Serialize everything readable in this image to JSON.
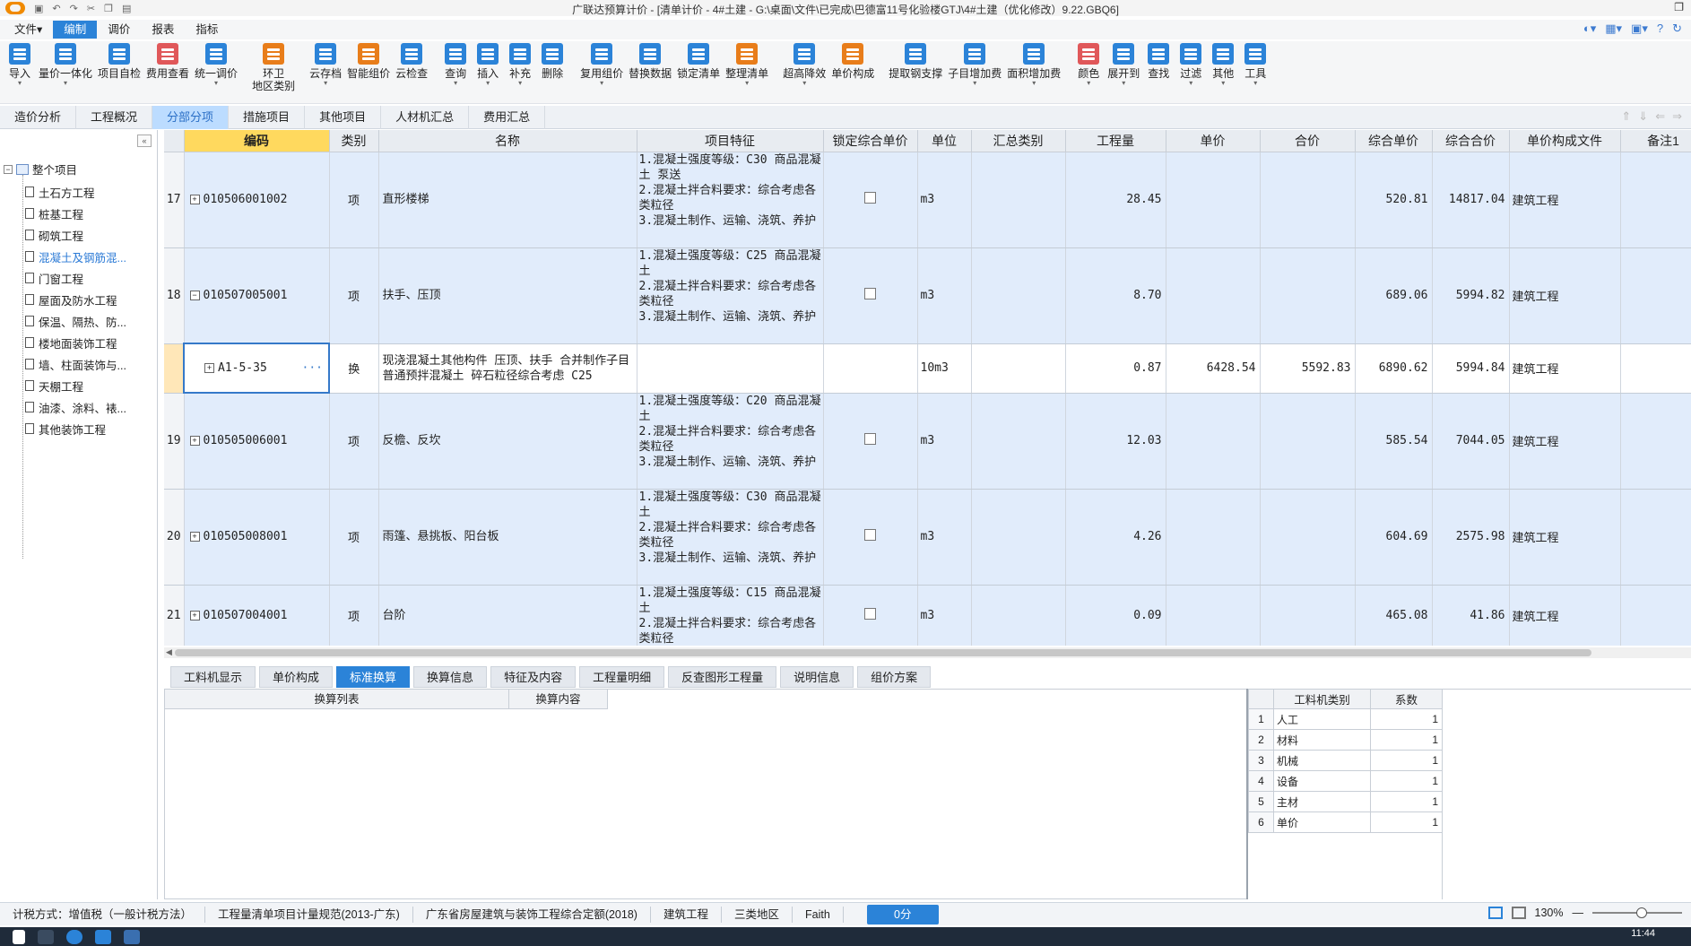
{
  "window": {
    "title": "广联达预算计价 - [清单计价 - 4#土建 - G:\\桌面\\文件\\已完成\\巴德富11号化验楼GTJ\\4#土建（优化修改）9.22.GBQ6]",
    "min_glyph": "—",
    "max_glyph": "▫",
    "restore_glyph": "❐",
    "close_glyph": "✕"
  },
  "menubar": {
    "items": [
      {
        "label": "文件▾",
        "active": false
      },
      {
        "label": "编制",
        "active": true
      },
      {
        "label": "调价",
        "active": false
      },
      {
        "label": "报表",
        "active": false
      },
      {
        "label": "指标",
        "active": false
      }
    ]
  },
  "toolbar": {
    "items": [
      {
        "label": "导入",
        "color": "#2b83d8",
        "caret": true
      },
      {
        "label": "量价一体化",
        "color": "#2b83d8",
        "caret": true
      },
      {
        "label": "项目自检",
        "color": "#2b83d8",
        "caret": false
      },
      {
        "label": "费用查看",
        "color": "#e0585a",
        "caret": false
      },
      {
        "label": "统一调价",
        "color": "#2b83d8",
        "caret": true
      },
      {
        "label": "环卫",
        "label2": "地区类别",
        "color": "#e87d1a",
        "caret": false
      },
      {
        "label": "云存档",
        "color": "#2b83d8",
        "caret": true
      },
      {
        "label": "智能组价",
        "color": "#e87d1a",
        "caret": false
      },
      {
        "label": "云检查",
        "color": "#2b83d8",
        "caret": false
      },
      {
        "label": "查询",
        "color": "#2b83d8",
        "caret": true
      },
      {
        "label": "插入",
        "color": "#2b83d8",
        "caret": true
      },
      {
        "label": "补充",
        "color": "#2b83d8",
        "caret": true
      },
      {
        "label": "删除",
        "color": "#2b83d8",
        "caret": false
      },
      {
        "label": "复用组价",
        "color": "#2b83d8",
        "caret": true
      },
      {
        "label": "替换数据",
        "color": "#2b83d8",
        "caret": false
      },
      {
        "label": "锁定清单",
        "color": "#2b83d8",
        "caret": false
      },
      {
        "label": "整理清单",
        "color": "#e87d1a",
        "caret": true
      },
      {
        "label": "超高降效",
        "color": "#2b83d8",
        "caret": true
      },
      {
        "label": "单价构成",
        "color": "#e87d1a",
        "caret": false
      },
      {
        "label": "提取钢支撑",
        "color": "#2b83d8",
        "caret": false
      },
      {
        "label": "子目增加费",
        "color": "#2b83d8",
        "caret": true
      },
      {
        "label": "面积增加费",
        "color": "#2b83d8",
        "caret": true
      },
      {
        "label": "颜色",
        "color": "#e0585a",
        "caret": true
      },
      {
        "label": "展开到",
        "color": "#2b83d8",
        "caret": true
      },
      {
        "label": "查找",
        "color": "#2b83d8",
        "caret": false
      },
      {
        "label": "过滤",
        "color": "#2b83d8",
        "caret": true
      },
      {
        "label": "其他",
        "color": "#2b83d8",
        "caret": true
      },
      {
        "label": "工具",
        "color": "#2b83d8",
        "caret": true
      }
    ]
  },
  "viewtabs": [
    {
      "label": "造价分析",
      "active": false
    },
    {
      "label": "工程概况",
      "active": false
    },
    {
      "label": "分部分项",
      "active": true
    },
    {
      "label": "措施项目",
      "active": false
    },
    {
      "label": "其他项目",
      "active": false
    },
    {
      "label": "人材机汇总",
      "active": false
    },
    {
      "label": "费用汇总",
      "active": false
    }
  ],
  "tree": {
    "collapse_label": "«",
    "root_toggle": "−",
    "root": "整个项目",
    "items": [
      {
        "label": "土石方工程",
        "active": false
      },
      {
        "label": "桩基工程",
        "active": false
      },
      {
        "label": "砌筑工程",
        "active": false
      },
      {
        "label": "混凝土及钢筋混...",
        "active": true
      },
      {
        "label": "门窗工程",
        "active": false
      },
      {
        "label": "屋面及防水工程",
        "active": false
      },
      {
        "label": "保温、隔热、防...",
        "active": false
      },
      {
        "label": "楼地面装饰工程",
        "active": false
      },
      {
        "label": "墙、柱面装饰与...",
        "active": false
      },
      {
        "label": "天棚工程",
        "active": false
      },
      {
        "label": "油漆、涂料、裱...",
        "active": false
      },
      {
        "label": "其他装饰工程",
        "active": false
      }
    ]
  },
  "grid": {
    "columns": [
      "",
      "编码",
      "类别",
      "名称",
      "项目特征",
      "锁定综合单价",
      "单位",
      "汇总类别",
      "工程量",
      "单价",
      "合价",
      "综合单价",
      "综合合价",
      "单价构成文件",
      "备注1"
    ],
    "rows": [
      {
        "type": "item",
        "num": "17",
        "toggle": "+",
        "code": "010506001002",
        "cat": "项",
        "name": "直形楼梯",
        "feature": "1.混凝土强度等级：C30 商品混凝土 泵送\n2.混凝土拌合料要求：综合考虑各类粒径\n3.混凝土制作、运输、浇筑、养护",
        "unit": "m3",
        "qty": "28.45",
        "price": "",
        "total": "",
        "cprice": "520.81",
        "ctotal": "14817.04",
        "file": "建筑工程"
      },
      {
        "type": "item",
        "num": "18",
        "toggle": "−",
        "code": "010507005001",
        "cat": "项",
        "name": "扶手、压顶",
        "feature": "1.混凝土强度等级：C25 商品混凝土\n2.混凝土拌合料要求：综合考虑各类粒径\n3.混凝土制作、运输、浇筑、养护",
        "unit": "m3",
        "qty": "8.70",
        "price": "",
        "total": "",
        "cprice": "689.06",
        "ctotal": "5994.82",
        "file": "建筑工程"
      },
      {
        "type": "sub",
        "num": "",
        "toggle": "+",
        "code": "A1-5-35",
        "dots": "···",
        "cat": "换",
        "name": "现浇混凝土其他构件 压顶、扶手  合并制作子目 普通预拌混凝土 碎石粒径综合考虑 C25",
        "feature": "",
        "unit": "10m3",
        "qty": "0.87",
        "price": "6428.54",
        "total": "5592.83",
        "cprice": "6890.62",
        "ctotal": "5994.84",
        "file": "建筑工程"
      },
      {
        "type": "item",
        "num": "19",
        "toggle": "+",
        "code": "010505006001",
        "cat": "项",
        "name": "反檐、反坎",
        "feature": "1.混凝土强度等级：C20 商品混凝土\n2.混凝土拌合料要求：综合考虑各类粒径\n3.混凝土制作、运输、浇筑、养护",
        "unit": "m3",
        "qty": "12.03",
        "price": "",
        "total": "",
        "cprice": "585.54",
        "ctotal": "7044.05",
        "file": "建筑工程"
      },
      {
        "type": "item",
        "num": "20",
        "toggle": "+",
        "code": "010505008001",
        "cat": "项",
        "name": "雨篷、悬挑板、阳台板",
        "feature": "1.混凝土强度等级：C30 商品混凝土\n2.混凝土拌合料要求：综合考虑各类粒径\n3.混凝土制作、运输、浇筑、养护",
        "unit": "m3",
        "qty": "4.26",
        "price": "",
        "total": "",
        "cprice": "604.69",
        "ctotal": "2575.98",
        "file": "建筑工程"
      },
      {
        "type": "item",
        "num": "21",
        "toggle": "+",
        "code": "010507004001",
        "cat": "项",
        "name": "台阶",
        "feature": "1.混凝土强度等级：C15 商品混凝土\n2.混凝土拌合料要求：综合考虑各类粒径",
        "unit": "m3",
        "qty": "0.09",
        "price": "",
        "total": "",
        "cprice": "465.08",
        "ctotal": "41.86",
        "file": "建筑工程"
      }
    ]
  },
  "bottom_tabs": [
    {
      "label": "工料机显示",
      "active": false
    },
    {
      "label": "单价构成",
      "active": false
    },
    {
      "label": "标准换算",
      "active": true
    },
    {
      "label": "换算信息",
      "active": false
    },
    {
      "label": "特征及内容",
      "active": false
    },
    {
      "label": "工程量明细",
      "active": false
    },
    {
      "label": "反查图形工程量",
      "active": false
    },
    {
      "label": "说明信息",
      "active": false
    },
    {
      "label": "组价方案",
      "active": false
    }
  ],
  "bottom_panel": {
    "col1": "换算列表",
    "col2": "换算内容"
  },
  "coef_table": {
    "headers": [
      "",
      "工料机类别",
      "系数"
    ],
    "rows": [
      {
        "n": "1",
        "t": "人工",
        "v": "1"
      },
      {
        "n": "2",
        "t": "材料",
        "v": "1"
      },
      {
        "n": "3",
        "t": "机械",
        "v": "1"
      },
      {
        "n": "4",
        "t": "设备",
        "v": "1"
      },
      {
        "n": "5",
        "t": "主材",
        "v": "1"
      },
      {
        "n": "6",
        "t": "单价",
        "v": "1"
      }
    ]
  },
  "statusbar": {
    "items": [
      "计税方式：增值税（一般计税方法）",
      "工程量清单项目计量规范(2013-广东)",
      "广东省房屋建筑与装饰工程综合定额(2018)",
      "建筑工程",
      "三类地区",
      "Faith"
    ],
    "progress": "0分",
    "zoom": "130%",
    "zoom_value": 0.55
  },
  "taskbar": {
    "time": "11:44"
  }
}
